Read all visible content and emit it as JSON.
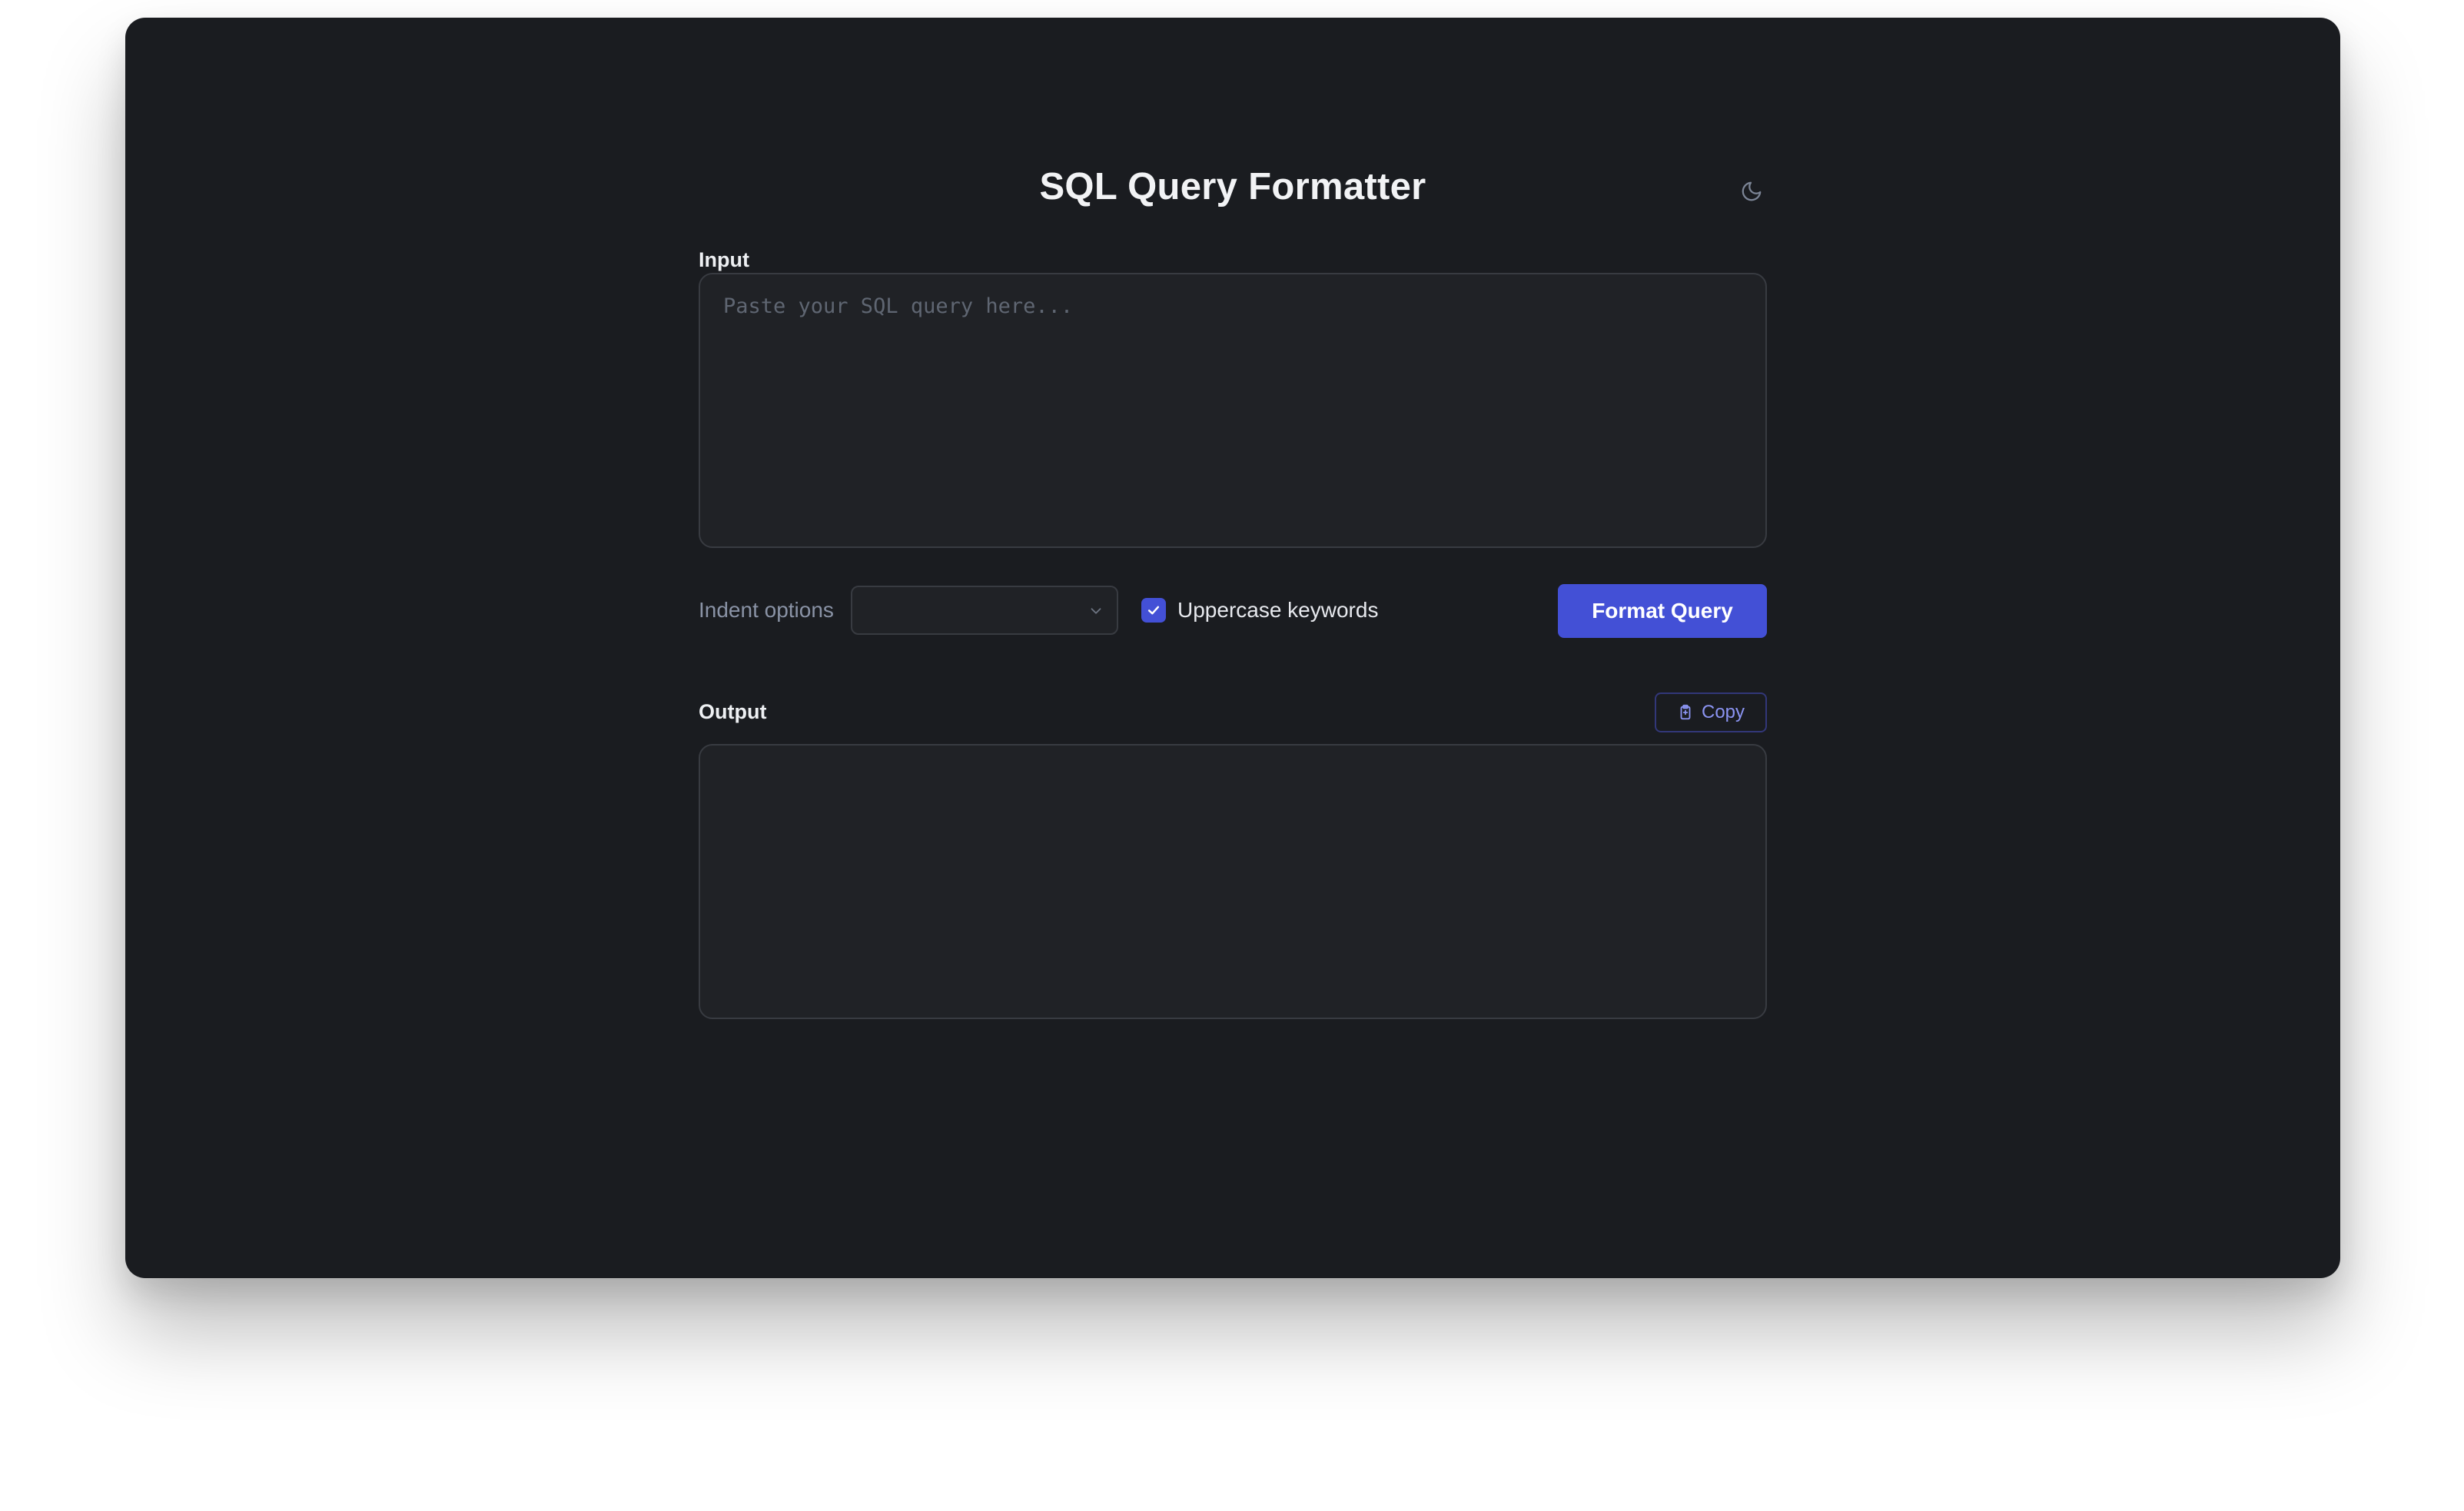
{
  "app": {
    "title": "SQL Query Formatter"
  },
  "theme_toggle": {
    "icon": "moon-icon"
  },
  "input": {
    "label": "Input",
    "value": "",
    "placeholder": "Paste your SQL query here..."
  },
  "controls": {
    "indent_label": "Indent options",
    "indent_selected": "",
    "uppercase_label": "Uppercase keywords",
    "uppercase_checked": true,
    "format_button": "Format Query"
  },
  "output": {
    "label": "Output",
    "value": "",
    "copy_label": "Copy",
    "copy_icon": "clipboard-icon"
  },
  "colors": {
    "background": "#1a1c20",
    "panel": "#202226",
    "accent": "#4350d6",
    "text": "#f2f3f5",
    "muted": "#8a93a6"
  }
}
